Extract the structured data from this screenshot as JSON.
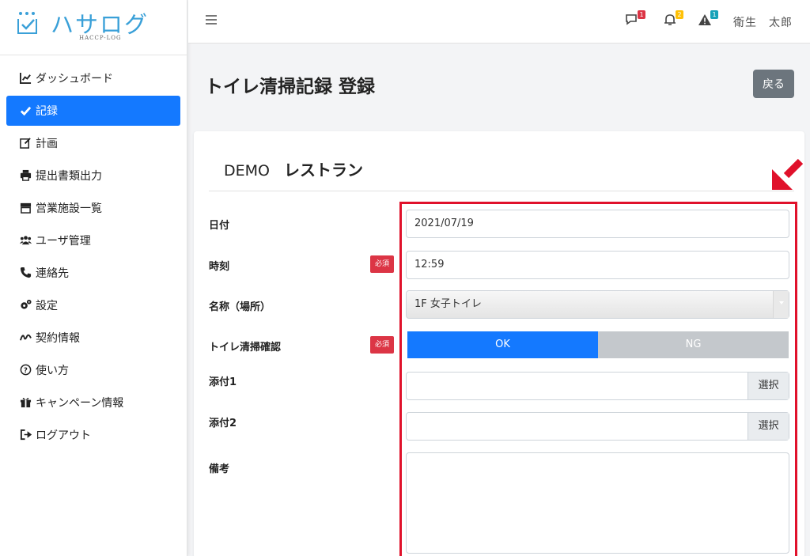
{
  "sidebar": {
    "logo_text": "ハサログ",
    "logo_sub": "HACCP-LOG",
    "items": [
      {
        "label": "ダッシュボード",
        "icon": "chart-line-icon"
      },
      {
        "label": "記録",
        "icon": "check-icon"
      },
      {
        "label": "計画",
        "icon": "edit-icon"
      },
      {
        "label": "提出書類出力",
        "icon": "print-icon"
      },
      {
        "label": "営業施設一覧",
        "icon": "store-icon"
      },
      {
        "label": "ユーザ管理",
        "icon": "users-icon"
      },
      {
        "label": "連絡先",
        "icon": "phone-icon"
      },
      {
        "label": "設定",
        "icon": "gears-icon"
      },
      {
        "label": "契約情報",
        "icon": "signature-icon"
      },
      {
        "label": "使い方",
        "icon": "question-circle-icon"
      },
      {
        "label": "キャンペーン情報",
        "icon": "gift-icon"
      },
      {
        "label": "ログアウト",
        "icon": "sign-out-icon"
      }
    ]
  },
  "topbar": {
    "messages_badge": "1",
    "notifications_badge": "2",
    "alerts_badge": "1",
    "user_name": "衛生　太郎",
    "colors": {
      "messages": "#dc3545",
      "notifications": "#ffc107",
      "alerts": "#17a2b8"
    }
  },
  "page": {
    "title": "トイレ清掃記録 登録",
    "back_label": "戻る"
  },
  "form": {
    "store_name": "DEMO",
    "store_sub": "レストラン",
    "required_label": "必須",
    "date_label": "日付",
    "date_value": "2021/07/19",
    "time_label": "時刻",
    "time_value": "12:59",
    "place_label": "名称（場所）",
    "place_value": "1F 女子トイレ",
    "check_label": "トイレ清掃確認",
    "ok_label": "OK",
    "ng_label": "NG",
    "attach1_label": "添付1",
    "attach2_label": "添付2",
    "select_label": "選択",
    "notes_label": "備考"
  },
  "colors": {
    "primary": "#1479ff",
    "danger": "#dc3545",
    "annotation": "#e0112b"
  }
}
